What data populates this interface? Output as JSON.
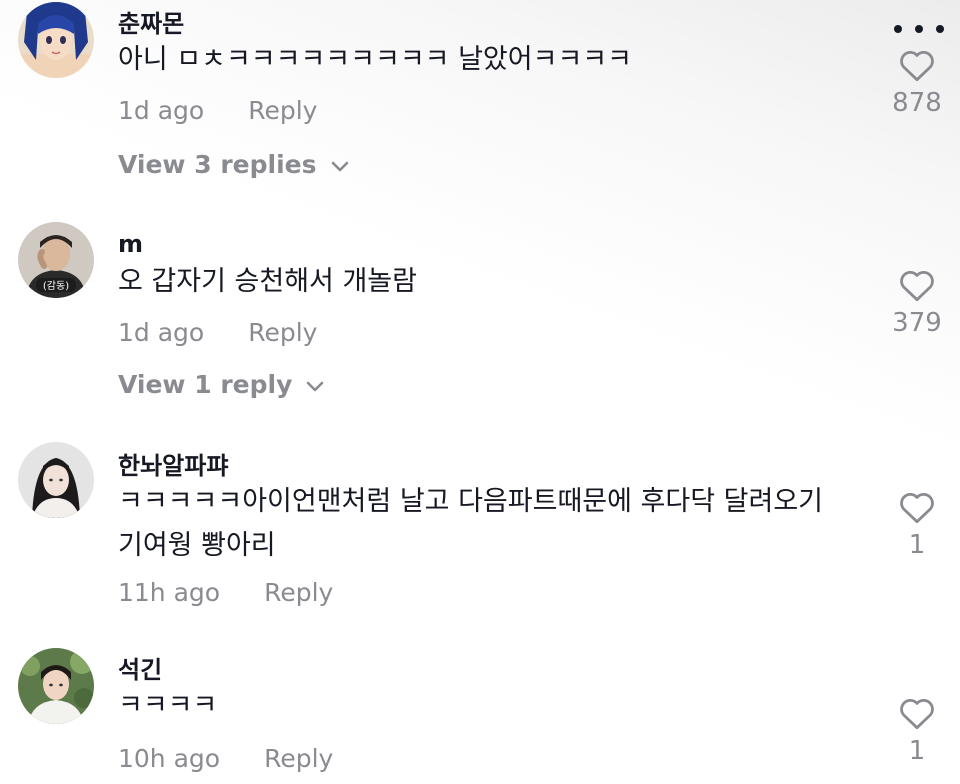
{
  "more_icon": "more-horizontal-icon",
  "comments": [
    {
      "username": "춘짜몬",
      "text": "아니 ㅁㅊㅋㅋㅋㅋㅋㅋㅋㅋㅋ 날았어ㅋㅋㅋㅋ",
      "time": "1d ago",
      "reply_label": "Reply",
      "likes": "878",
      "view_replies": "View 3 replies"
    },
    {
      "username": "m",
      "text": "오 갑자기 승천해서 개놀람",
      "time": "1d ago",
      "reply_label": "Reply",
      "likes": "379",
      "view_replies": "View 1 reply",
      "avatar_caption": "(감동)"
    },
    {
      "username": "한놔알파퍄",
      "text": "ㅋㅋㅋㅋㅋ아이언맨처럼 날고 다음파트때문에 후다닥 달려오기 기여웡 뽱아리",
      "time": "11h ago",
      "reply_label": "Reply",
      "likes": "1"
    },
    {
      "username": "석긴",
      "text": "ㅋㅋㅋㅋ",
      "time": "10h ago",
      "reply_label": "Reply",
      "likes": "1"
    }
  ],
  "colors": {
    "text": "#161823",
    "muted": "#8a8b91"
  }
}
